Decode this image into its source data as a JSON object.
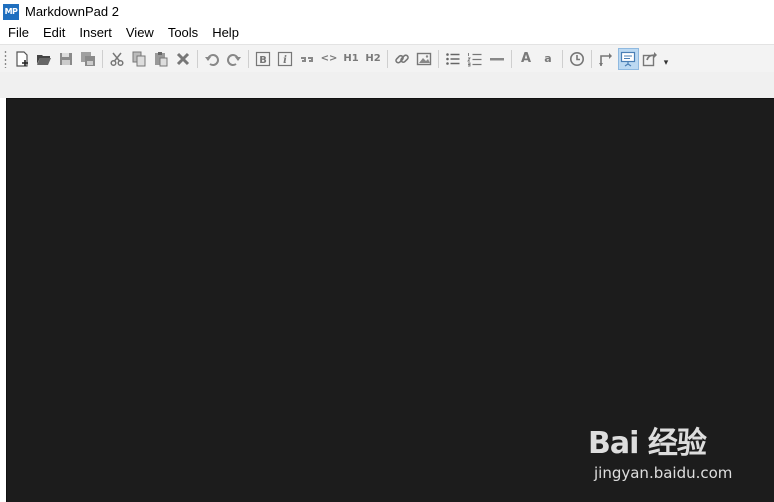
{
  "window": {
    "icon_text": "MP",
    "title": "MarkdownPad 2"
  },
  "menu": [
    "File",
    "Edit",
    "Insert",
    "View",
    "Tools",
    "Help"
  ],
  "toolbar": {
    "heading1_label": "H1",
    "heading2_label": "H2",
    "font_larger_label": "A",
    "font_smaller_label": "a",
    "bold_label": "B",
    "italic_label": "i",
    "code_label": "<>",
    "overflow_label": "▾"
  },
  "watermark": {
    "logo": "Bai 经验",
    "url": "jingyan.baidu.com"
  },
  "colors": {
    "editor_background": "#1c1c1c",
    "active_button": "#bcd9f2",
    "icon_gray": "#7a7a7a",
    "app_icon_blue": "#1f6fbf"
  }
}
